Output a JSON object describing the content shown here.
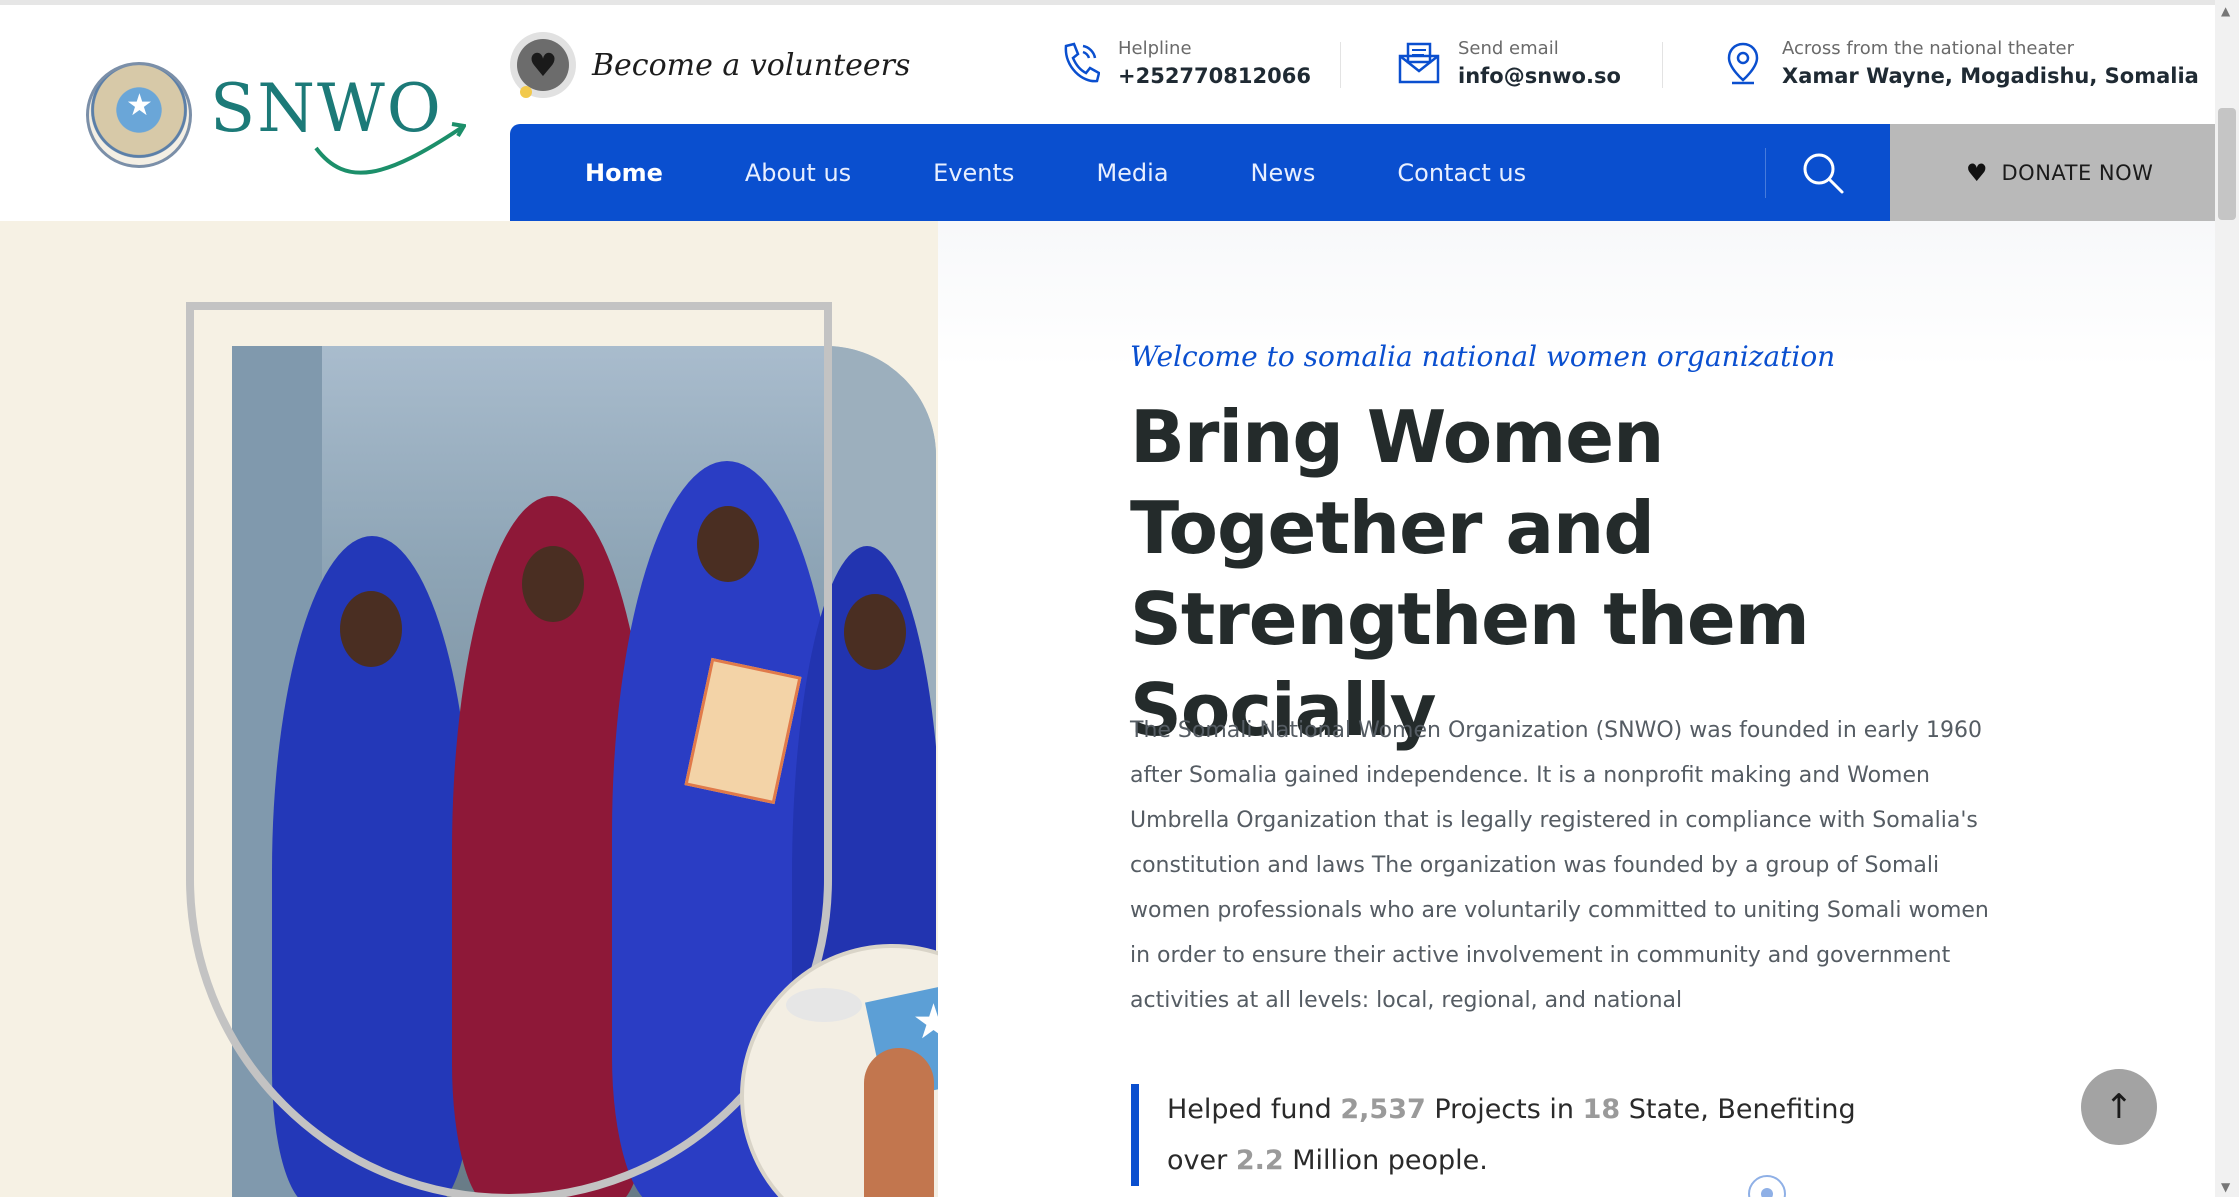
{
  "header": {
    "logo_text": "SNWO",
    "volunteer": {
      "icon": "heart-icon",
      "label": "Become a volunteers"
    },
    "contacts": [
      {
        "icon": "phone-icon",
        "label": "Helpline",
        "value": "+252770812066"
      },
      {
        "icon": "envelope-icon",
        "label": "Send email",
        "value": "info@snwo.so"
      },
      {
        "icon": "map-pin-icon",
        "label": "Across from the national theater",
        "value": "Xamar Wayne, Mogadishu, Somalia"
      }
    ]
  },
  "nav": {
    "items": [
      {
        "label": "Home",
        "active": true
      },
      {
        "label": "About us"
      },
      {
        "label": "Events"
      },
      {
        "label": "Media"
      },
      {
        "label": "News"
      },
      {
        "label": "Contact us"
      }
    ],
    "search_icon": "search-icon",
    "donate_label": "DONATE NOW",
    "donate_icon": "heart-icon"
  },
  "hero": {
    "welcome": "Welcome to somalia national women organization",
    "headline": "Bring Women Together and Strengthen them Socially",
    "description": "The Somali National Women Organization (SNWO) was founded in early 1960 after Somalia gained independence. It is a nonprofit making and Women Umbrella Organization that is legally registered in compliance with Somalia's constitution and laws The organization was founded by a group of Somali women professionals who are voluntarily committed to uniting Somali women in order to ensure their active involvement in community and government activities at all levels: local, regional, and national",
    "stat": {
      "t1": "Helped fund",
      "projects": "2,537",
      "t2": "Projects in",
      "states": "18",
      "t3": "State, Benefiting over",
      "people": "2.2",
      "t4": "Million people."
    }
  },
  "colors": {
    "primary": "#0a4fcf",
    "donate_bg": "#b9b9b9",
    "hero_left_bg": "#f6f1e4",
    "heading": "#242b2b"
  },
  "back_to_top_icon": "arrow-up-icon"
}
